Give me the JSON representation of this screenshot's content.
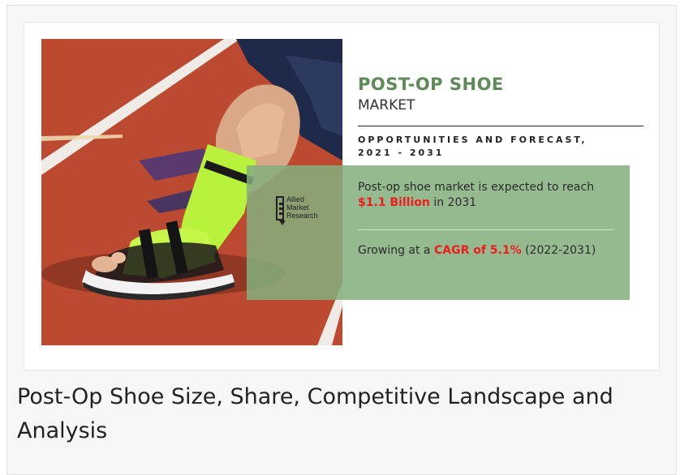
{
  "hero": {
    "title": "POST-OP SHOE",
    "subtitle": "MARKET",
    "section_heading_line1": "OPPORTUNITIES AND FORECAST,",
    "section_heading_line2": "2021 - 2031",
    "photo_alt": "Foot in green cast wearing post-op shoe on running track"
  },
  "logo": {
    "line1": "Allied",
    "line2": "Market",
    "line3": "Research"
  },
  "stats": {
    "market_text": "Post-op shoe market is expected to reach ",
    "market_value": "$1.1 Billion",
    "market_suffix": " in 2031",
    "growth_text": "Growing at a ",
    "growth_value": "CAGR of 5.1%",
    "growth_suffix": " (2022-2031)"
  },
  "caption": {
    "text": "Post-Op Shoe Size, Share, Competitive Landscape and Analysis"
  },
  "colors": {
    "accent_green": "#5d8a56",
    "highlight_red": "#ee1c1c",
    "overlay_green": "#84af7d"
  }
}
